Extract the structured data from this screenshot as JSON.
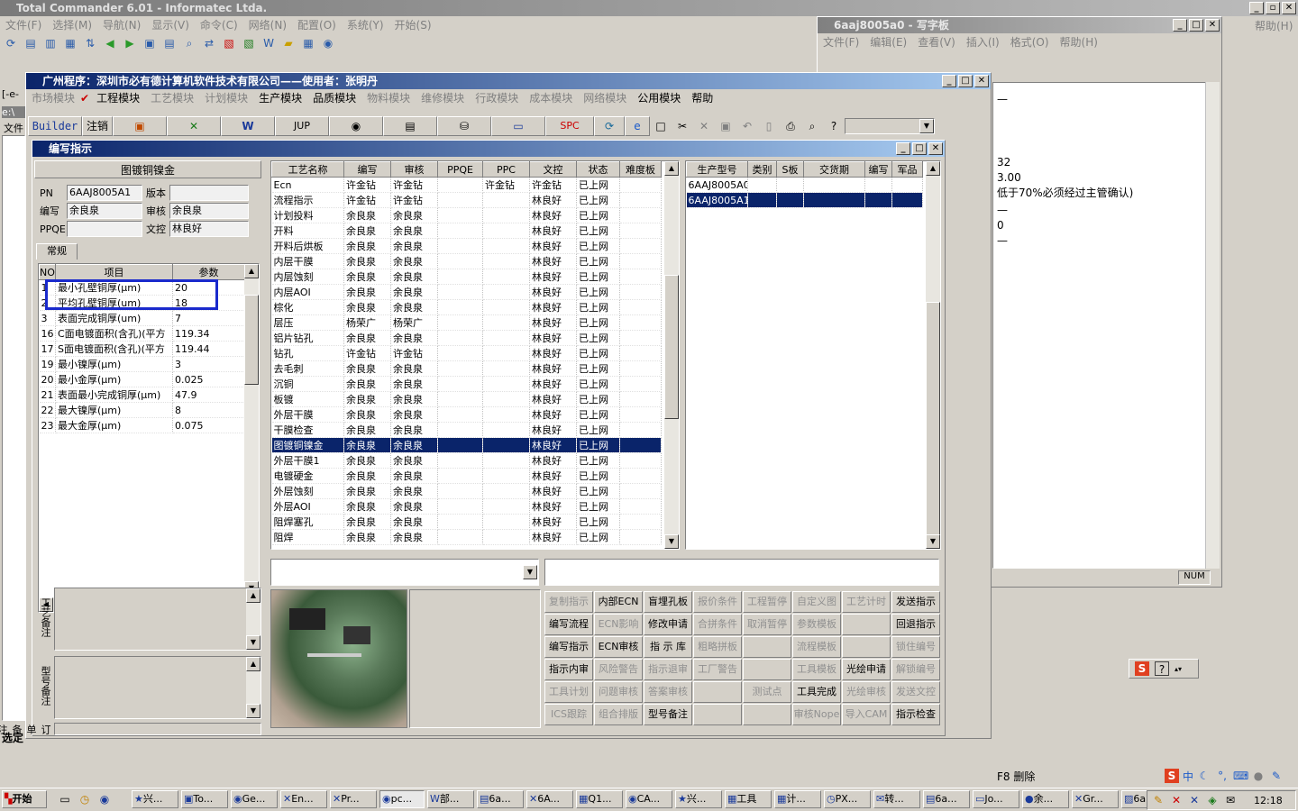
{
  "tc": {
    "title": "Total Commander 6.01 - Informatec Ltda.",
    "menu": [
      "文件(F)",
      "选择(M)",
      "导航(N)",
      "显示(V)",
      "命令(C)",
      "网络(N)",
      "配置(O)",
      "系统(Y)",
      "开始(S)",
      "帮助(H)"
    ],
    "left_path": "[-e-",
    "drive_label": "e:\\",
    "files_label": "文件",
    "select_label": "选定",
    "f8": "F8 删除"
  },
  "wordpad": {
    "title": "6aaj8005a0 - 写字板",
    "menu": [
      "文件(F)",
      "编辑(E)",
      "查看(V)",
      "插入(I)",
      "格式(O)",
      "帮助(H)"
    ],
    "lines": [
      "—",
      "",
      "32",
      "3.00",
      "低于70%必须经过主管确认)",
      "—",
      "0",
      "—"
    ],
    "status": "NUM"
  },
  "app": {
    "title": "广州程序：深圳市必有德计算机软件技术有限公司——使用者：张明丹",
    "menu": [
      "市场模块",
      "工程模块",
      "工艺模块",
      "计划模块",
      "生产模块",
      "品质模块",
      "物料模块",
      "维修模块",
      "行政模块",
      "成本模块",
      "网络模块",
      "公用模块",
      "帮助"
    ],
    "menu_enabled": [
      false,
      true,
      false,
      false,
      true,
      true,
      false,
      false,
      false,
      false,
      false,
      true,
      true
    ],
    "toolbar": {
      "builder": "Builder",
      "logout": "注销",
      "jup": "JUP",
      "spc": "SPC"
    }
  },
  "dialog": {
    "title": "编写指示",
    "header": "图镀铜镍金",
    "pn_label": "PN",
    "pn": "6AAJ8005A1",
    "version_label": "版本",
    "version": "",
    "writer_label": "编写",
    "writer": "余良泉",
    "reviewer_label": "审核",
    "reviewer": "余良泉",
    "ppqe_label": "PPQE",
    "ppqe": "",
    "doc_label": "文控",
    "doc": "林良好",
    "tab": "常规",
    "param_cols": [
      "NO",
      "项目",
      "参数"
    ],
    "params": [
      [
        "1",
        "最小孔壁铜厚(μm)",
        "20"
      ],
      [
        "2",
        "平均孔壁铜厚(um)",
        "18"
      ],
      [
        "3",
        "表面完成铜厚(um)",
        "7"
      ],
      [
        "16",
        "C面电镀面积(含孔)(平方",
        "119.34"
      ],
      [
        "17",
        "S面电镀面积(含孔)(平方",
        "119.44"
      ],
      [
        "19",
        "最小镍厚(μm)",
        "3"
      ],
      [
        "20",
        "最小金厚(μm)",
        "0.025"
      ],
      [
        "21",
        "表面最小完成铜厚(μm)",
        "47.9"
      ],
      [
        "22",
        "最大镍厚(μm)",
        "8"
      ],
      [
        "23",
        "最大金厚(μm)",
        "0.075"
      ]
    ],
    "note_labels": [
      "工艺备注",
      "型号备注",
      "订单备注"
    ],
    "proc_cols": [
      "工艺名称",
      "编写",
      "审核",
      "PPQE",
      "PPC",
      "文控",
      "状态",
      "难度板"
    ],
    "procs": [
      [
        "Ecn",
        "许金钻",
        "许金钻",
        "",
        "许金钻",
        "许金钻",
        "已上网",
        ""
      ],
      [
        "流程指示",
        "许金钻",
        "许金钻",
        "",
        "",
        "林良好",
        "已上网",
        ""
      ],
      [
        "计划投料",
        "余良泉",
        "余良泉",
        "",
        "",
        "林良好",
        "已上网",
        ""
      ],
      [
        "开料",
        "余良泉",
        "余良泉",
        "",
        "",
        "林良好",
        "已上网",
        ""
      ],
      [
        "开料后烘板",
        "余良泉",
        "余良泉",
        "",
        "",
        "林良好",
        "已上网",
        ""
      ],
      [
        "内层干膜",
        "余良泉",
        "余良泉",
        "",
        "",
        "林良好",
        "已上网",
        ""
      ],
      [
        "内层蚀刻",
        "余良泉",
        "余良泉",
        "",
        "",
        "林良好",
        "已上网",
        ""
      ],
      [
        "内层AOI",
        "余良泉",
        "余良泉",
        "",
        "",
        "林良好",
        "已上网",
        ""
      ],
      [
        "棕化",
        "余良泉",
        "余良泉",
        "",
        "",
        "林良好",
        "已上网",
        ""
      ],
      [
        "层压",
        "杨荣广",
        "杨荣广",
        "",
        "",
        "林良好",
        "已上网",
        ""
      ],
      [
        "铝片钻孔",
        "余良泉",
        "余良泉",
        "",
        "",
        "林良好",
        "已上网",
        ""
      ],
      [
        "钻孔",
        "许金钻",
        "许金钻",
        "",
        "",
        "林良好",
        "已上网",
        ""
      ],
      [
        "去毛刺",
        "余良泉",
        "余良泉",
        "",
        "",
        "林良好",
        "已上网",
        ""
      ],
      [
        "沉铜",
        "余良泉",
        "余良泉",
        "",
        "",
        "林良好",
        "已上网",
        ""
      ],
      [
        "板镀",
        "余良泉",
        "余良泉",
        "",
        "",
        "林良好",
        "已上网",
        ""
      ],
      [
        "外层干膜",
        "余良泉",
        "余良泉",
        "",
        "",
        "林良好",
        "已上网",
        ""
      ],
      [
        "干膜检查",
        "余良泉",
        "余良泉",
        "",
        "",
        "林良好",
        "已上网",
        ""
      ],
      [
        "图镀铜镍金",
        "余良泉",
        "余良泉",
        "",
        "",
        "林良好",
        "已上网",
        ""
      ],
      [
        "外层干膜1",
        "余良泉",
        "余良泉",
        "",
        "",
        "林良好",
        "已上网",
        ""
      ],
      [
        "电镀硬金",
        "余良泉",
        "余良泉",
        "",
        "",
        "林良好",
        "已上网",
        ""
      ],
      [
        "外层蚀刻",
        "余良泉",
        "余良泉",
        "",
        "",
        "林良好",
        "已上网",
        ""
      ],
      [
        "外层AOI",
        "余良泉",
        "余良泉",
        "",
        "",
        "林良好",
        "已上网",
        ""
      ],
      [
        "阻焊塞孔",
        "余良泉",
        "余良泉",
        "",
        "",
        "林良好",
        "已上网",
        ""
      ],
      [
        "阻焊",
        "余良泉",
        "余良泉",
        "",
        "",
        "林良好",
        "已上网",
        ""
      ]
    ],
    "selected_proc": 17,
    "model_cols": [
      "生产型号",
      "类别",
      "S板",
      "交货期",
      "编写",
      "军品"
    ],
    "models": [
      [
        "6AAJ8005A0",
        "",
        "",
        "",
        "",
        ""
      ],
      [
        "6AAJ8005A1",
        "",
        "",
        "",
        "",
        ""
      ]
    ],
    "selected_model": 1,
    "buttons": [
      [
        "复制指示",
        "内部ECN",
        "盲埋孔板",
        "报价条件",
        "工程暂停",
        "自定义图",
        "工艺计时",
        "发送指示"
      ],
      [
        "编写流程",
        "ECN影响",
        "修改申请",
        "合拼条件",
        "取消暂停",
        "参数模板",
        "",
        "回退指示"
      ],
      [
        "编写指示",
        "ECN审核",
        "指 示 库",
        "粗略拼板",
        "",
        "流程模板",
        "",
        "锁住编号"
      ],
      [
        "指示内审",
        "风险警告",
        "指示退审",
        "工厂警告",
        "",
        "工具模板",
        "光绘申请",
        "解锁编号"
      ],
      [
        "工具计划",
        "问题审核",
        "答案审核",
        "",
        "测试点",
        "工具完成",
        "光绘审核",
        "发送文控"
      ],
      [
        "ICS跟踪",
        "组合排版",
        "型号备注",
        "",
        "",
        "审核Nope",
        "导入CAM",
        "指示检查"
      ]
    ],
    "buttons_enabled": [
      [
        false,
        true,
        true,
        false,
        false,
        false,
        false,
        true
      ],
      [
        true,
        false,
        true,
        false,
        false,
        false,
        false,
        true
      ],
      [
        true,
        true,
        true,
        false,
        false,
        false,
        false,
        false
      ],
      [
        true,
        false,
        false,
        false,
        false,
        false,
        true,
        false
      ],
      [
        false,
        false,
        false,
        false,
        false,
        true,
        false,
        false
      ],
      [
        false,
        false,
        true,
        false,
        false,
        false,
        false,
        true
      ]
    ]
  },
  "taskbar": {
    "start": "开始",
    "clock": "12:18",
    "items": [
      "兴...",
      "To...",
      "Ge...",
      "En...",
      "Pr...",
      "pc...",
      "部...",
      "6a...",
      "6A...",
      "Q1...",
      "CA...",
      "兴...",
      "工具",
      "计...",
      "PX...",
      "转...",
      "6a...",
      "Jo...",
      "余...",
      "Gr...",
      "6a..."
    ]
  },
  "ime": {
    "lang": "中"
  }
}
